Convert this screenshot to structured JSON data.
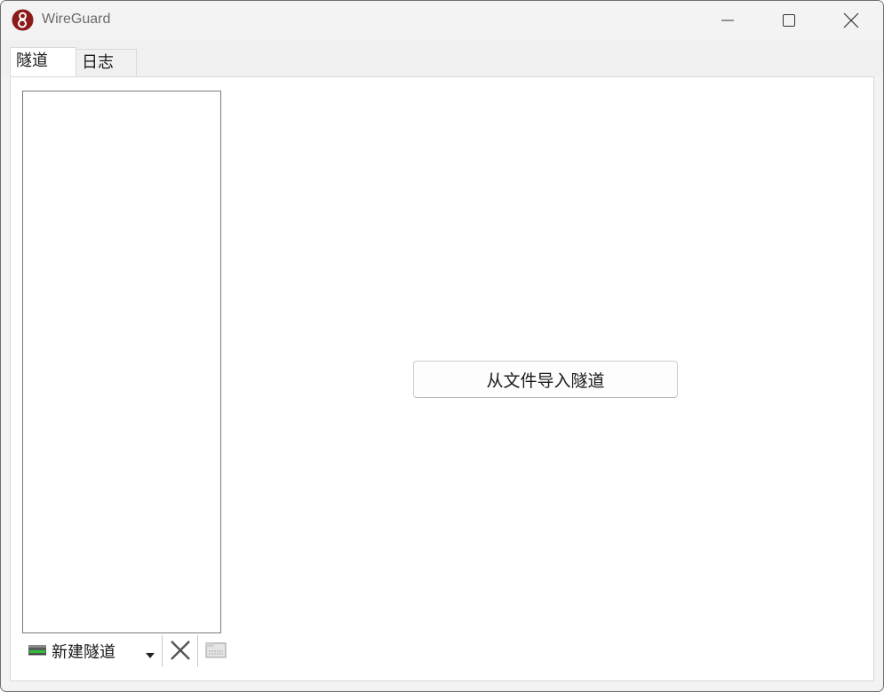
{
  "window": {
    "title": "WireGuard",
    "accent_color": "#8b1a1a"
  },
  "tabs": [
    {
      "label": "隧道",
      "selected": true
    },
    {
      "label": "日志",
      "selected": false
    }
  ],
  "toolbar": {
    "add_tunnel_label": "新建隧道",
    "add_tunnel_icon": "network-adapter-icon",
    "dropdown_icon": "dropdown-arrow-icon",
    "delete_icon": "delete-x-icon",
    "export_icon": "export-zip-icon"
  },
  "main": {
    "import_button_label": "从文件导入隧道"
  }
}
